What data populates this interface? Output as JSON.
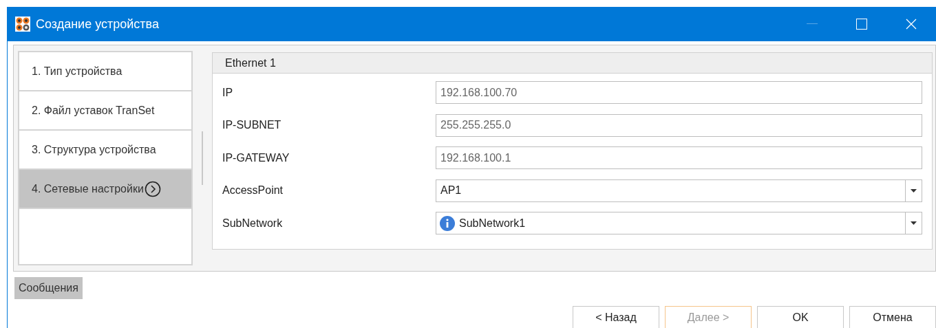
{
  "window": {
    "title": "Создание устройства",
    "minimize_enabled": false
  },
  "steps": [
    {
      "label": "1. Тип устройства",
      "selected": false
    },
    {
      "label": "2. Файл уставок TranSet",
      "selected": false
    },
    {
      "label": "3. Структура устройства",
      "selected": false
    },
    {
      "label": "4. Сетевые настройки",
      "selected": true
    }
  ],
  "group": {
    "title": "Ethernet 1",
    "fields": [
      {
        "label": "IP",
        "kind": "text",
        "value": "192.168.100.70",
        "readonly": true
      },
      {
        "label": "IP-SUBNET",
        "kind": "text",
        "value": "255.255.255.0",
        "readonly": true
      },
      {
        "label": "IP-GATEWAY",
        "kind": "text",
        "value": "192.168.100.1",
        "readonly": true
      },
      {
        "label": "AccessPoint",
        "kind": "combo",
        "value": "AP1",
        "info": false
      },
      {
        "label": "SubNetwork",
        "kind": "combo",
        "value": "SubNetwork1",
        "info": true
      }
    ]
  },
  "messages_tab": "Сообщения",
  "buttons": [
    {
      "label": "< Назад",
      "disabled": false
    },
    {
      "label": "Далее >",
      "disabled": true
    },
    {
      "label": "OK",
      "disabled": false
    },
    {
      "label": "Отмена",
      "disabled": false
    }
  ]
}
